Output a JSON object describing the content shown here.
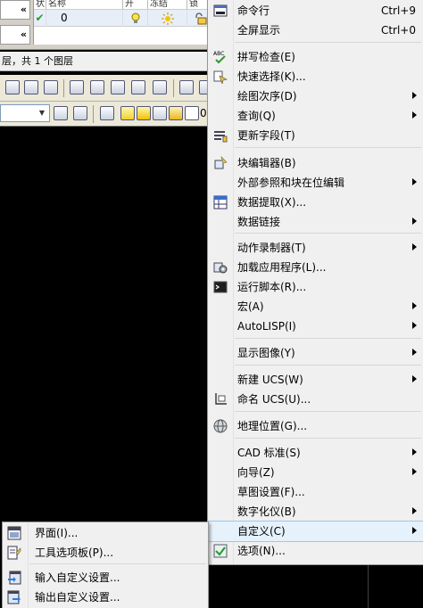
{
  "layers_panel": {
    "collapse_glyph": "«",
    "columns": [
      "状",
      "名称",
      "开",
      "冻结",
      "锁"
    ],
    "row": {
      "status": "✔",
      "name": "0"
    },
    "layer_count_text": "层，共 1 个图层"
  },
  "main_menu": {
    "items": [
      {
        "label": "命令行",
        "shortcut": "Ctrl+9",
        "icon": "command-line-icon",
        "submenu": false
      },
      {
        "label": "全屏显示",
        "shortcut": "Ctrl+0",
        "icon": "",
        "submenu": false
      },
      {
        "label": "拼写检查(E)",
        "shortcut": "",
        "icon": "spell-check-icon",
        "submenu": false
      },
      {
        "label": "快速选择(K)...",
        "shortcut": "",
        "icon": "quick-select-icon",
        "submenu": false
      },
      {
        "label": "绘图次序(D)",
        "shortcut": "",
        "icon": "",
        "submenu": true
      },
      {
        "label": "查询(Q)",
        "shortcut": "",
        "icon": "",
        "submenu": true
      },
      {
        "label": "更新字段(T)",
        "shortcut": "",
        "icon": "update-fields-icon",
        "submenu": false
      },
      {
        "label": "块编辑器(B)",
        "shortcut": "",
        "icon": "block-editor-icon",
        "submenu": false
      },
      {
        "label": "外部参照和块在位编辑",
        "shortcut": "",
        "icon": "",
        "submenu": true
      },
      {
        "label": "数据提取(X)...",
        "shortcut": "",
        "icon": "data-extraction-icon",
        "submenu": false
      },
      {
        "label": "数据链接",
        "shortcut": "",
        "icon": "",
        "submenu": true
      },
      {
        "label": "动作录制器(T)",
        "shortcut": "",
        "icon": "",
        "submenu": true
      },
      {
        "label": "加载应用程序(L)...",
        "shortcut": "",
        "icon": "load-application-icon",
        "submenu": false
      },
      {
        "label": "运行脚本(R)...",
        "shortcut": "",
        "icon": "run-script-icon",
        "submenu": false
      },
      {
        "label": "宏(A)",
        "shortcut": "",
        "icon": "",
        "submenu": true
      },
      {
        "label": "AutoLISP(I)",
        "shortcut": "",
        "icon": "",
        "submenu": true
      },
      {
        "label": "显示图像(Y)",
        "shortcut": "",
        "icon": "",
        "submenu": true
      },
      {
        "label": "新建 UCS(W)",
        "shortcut": "",
        "icon": "",
        "submenu": true
      },
      {
        "label": "命名 UCS(U)...",
        "shortcut": "",
        "icon": "named-ucs-icon",
        "submenu": false
      },
      {
        "label": "地理位置(G)...",
        "shortcut": "",
        "icon": "geographic-location-icon",
        "submenu": false
      },
      {
        "label": "CAD 标准(S)",
        "shortcut": "",
        "icon": "",
        "submenu": true
      },
      {
        "label": "向导(Z)",
        "shortcut": "",
        "icon": "",
        "submenu": true
      },
      {
        "label": "草图设置(F)...",
        "shortcut": "",
        "icon": "",
        "submenu": false
      },
      {
        "label": "数字化仪(B)",
        "shortcut": "",
        "icon": "",
        "submenu": true
      },
      {
        "label": "自定义(C)",
        "shortcut": "",
        "icon": "",
        "submenu": true,
        "highlighted": true
      },
      {
        "label": "选项(N)...",
        "shortcut": "",
        "icon": "options-check-icon",
        "submenu": false
      }
    ]
  },
  "sub_menu": {
    "items": [
      {
        "label": "界面(I)...",
        "icon": "interface-icon"
      },
      {
        "label": "工具选项板(P)...",
        "icon": "tool-palettes-icon"
      },
      {
        "label": "输入自定义设置...",
        "icon": "import-customizations-icon"
      },
      {
        "label": "输出自定义设置...",
        "icon": "export-customizations-icon"
      }
    ]
  },
  "toolbar2": {
    "zero_label": "0"
  },
  "colors": {
    "highlight": "#e5f1fb",
    "menu_bg": "#f0f0f0",
    "canvas": "#000000"
  }
}
